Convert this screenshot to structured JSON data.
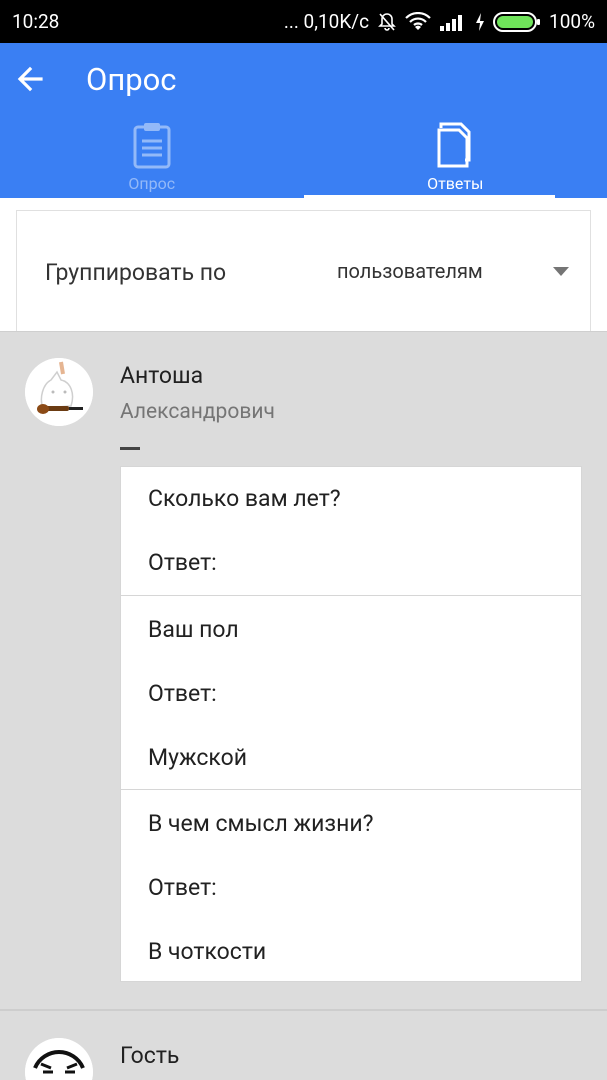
{
  "status_bar": {
    "time": "10:28",
    "speed": "... 0,10K/c",
    "battery": "100%"
  },
  "app_bar": {
    "title": "Опрос",
    "tabs": [
      {
        "label": "Опрос",
        "icon": "clipboard-icon",
        "active": false
      },
      {
        "label": "Ответы",
        "icon": "documents-icon",
        "active": true
      }
    ]
  },
  "group_by": {
    "label": "Группировать по",
    "selected": "пользователям"
  },
  "respondents": [
    {
      "name": "Антоша",
      "subtitle": "Александрович",
      "avatar": "cat-ukulele-avatar",
      "answers": [
        {
          "question": "Сколько вам лет?",
          "answer_label": "Ответ:",
          "answer": ""
        },
        {
          "question": "Ваш пол",
          "answer_label": "Ответ:",
          "answer": "Мужской"
        },
        {
          "question": "В чем смысл жизни?",
          "answer_label": "Ответ:",
          "answer": "В чоткости"
        }
      ]
    },
    {
      "name": "Гость",
      "subtitle": "",
      "avatar": "mask-avatar"
    }
  ],
  "colors": {
    "primary": "#3a7ff3",
    "status_bar": "#000000",
    "background": "#dcdcdc",
    "card": "#ffffff"
  }
}
